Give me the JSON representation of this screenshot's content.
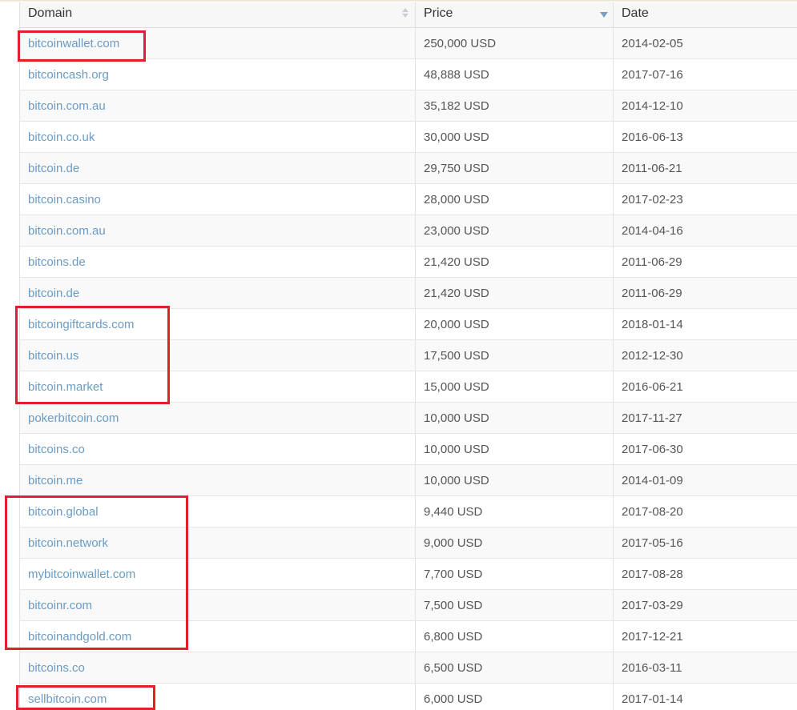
{
  "table": {
    "headers": {
      "domain": "Domain",
      "price": "Price",
      "date": "Date"
    },
    "sort": {
      "column": "price",
      "direction": "descending"
    },
    "rows": [
      {
        "domain": "bitcoinwallet.com",
        "price": "250,000 USD",
        "date": "2014-02-05"
      },
      {
        "domain": "bitcoincash.org",
        "price": "48,888 USD",
        "date": "2017-07-16"
      },
      {
        "domain": "bitcoin.com.au",
        "price": "35,182 USD",
        "date": "2014-12-10"
      },
      {
        "domain": "bitcoin.co.uk",
        "price": "30,000 USD",
        "date": "2016-06-13"
      },
      {
        "domain": "bitcoin.de",
        "price": "29,750 USD",
        "date": "2011-06-21"
      },
      {
        "domain": "bitcoin.casino",
        "price": "28,000 USD",
        "date": "2017-02-23"
      },
      {
        "domain": "bitcoin.com.au",
        "price": "23,000 USD",
        "date": "2014-04-16"
      },
      {
        "domain": "bitcoins.de",
        "price": "21,420 USD",
        "date": "2011-06-29"
      },
      {
        "domain": "bitcoin.de",
        "price": "21,420 USD",
        "date": "2011-06-29"
      },
      {
        "domain": "bitcoingiftcards.com",
        "price": "20,000 USD",
        "date": "2018-01-14"
      },
      {
        "domain": "bitcoin.us",
        "price": "17,500 USD",
        "date": "2012-12-30"
      },
      {
        "domain": "bitcoin.market",
        "price": "15,000 USD",
        "date": "2016-06-21"
      },
      {
        "domain": "pokerbitcoin.com",
        "price": "10,000 USD",
        "date": "2017-11-27"
      },
      {
        "domain": "bitcoins.co",
        "price": "10,000 USD",
        "date": "2017-06-30"
      },
      {
        "domain": "bitcoin.me",
        "price": "10,000 USD",
        "date": "2014-01-09"
      },
      {
        "domain": "bitcoin.global",
        "price": "9,440 USD",
        "date": "2017-08-20"
      },
      {
        "domain": "bitcoin.network",
        "price": "9,000 USD",
        "date": "2017-05-16"
      },
      {
        "domain": "mybitcoinwallet.com",
        "price": "7,700 USD",
        "date": "2017-08-28"
      },
      {
        "domain": "bitcoinr.com",
        "price": "7,500 USD",
        "date": "2017-03-29"
      },
      {
        "domain": "bitcoinandgold.com",
        "price": "6,800 USD",
        "date": "2017-12-21"
      },
      {
        "domain": "bitcoins.co",
        "price": "6,500 USD",
        "date": "2016-03-11"
      },
      {
        "domain": "sellbitcoin.com",
        "price": "6,000 USD",
        "date": "2017-01-14"
      }
    ]
  },
  "colors": {
    "link": "#6b9bc3",
    "highlight": "#e3202a",
    "stripe": "#f9f9f9",
    "sort_active": "#7a9cc6"
  },
  "icons": {
    "domain_sort": "sort-both-icon",
    "price_sort": "sort-desc-icon"
  }
}
